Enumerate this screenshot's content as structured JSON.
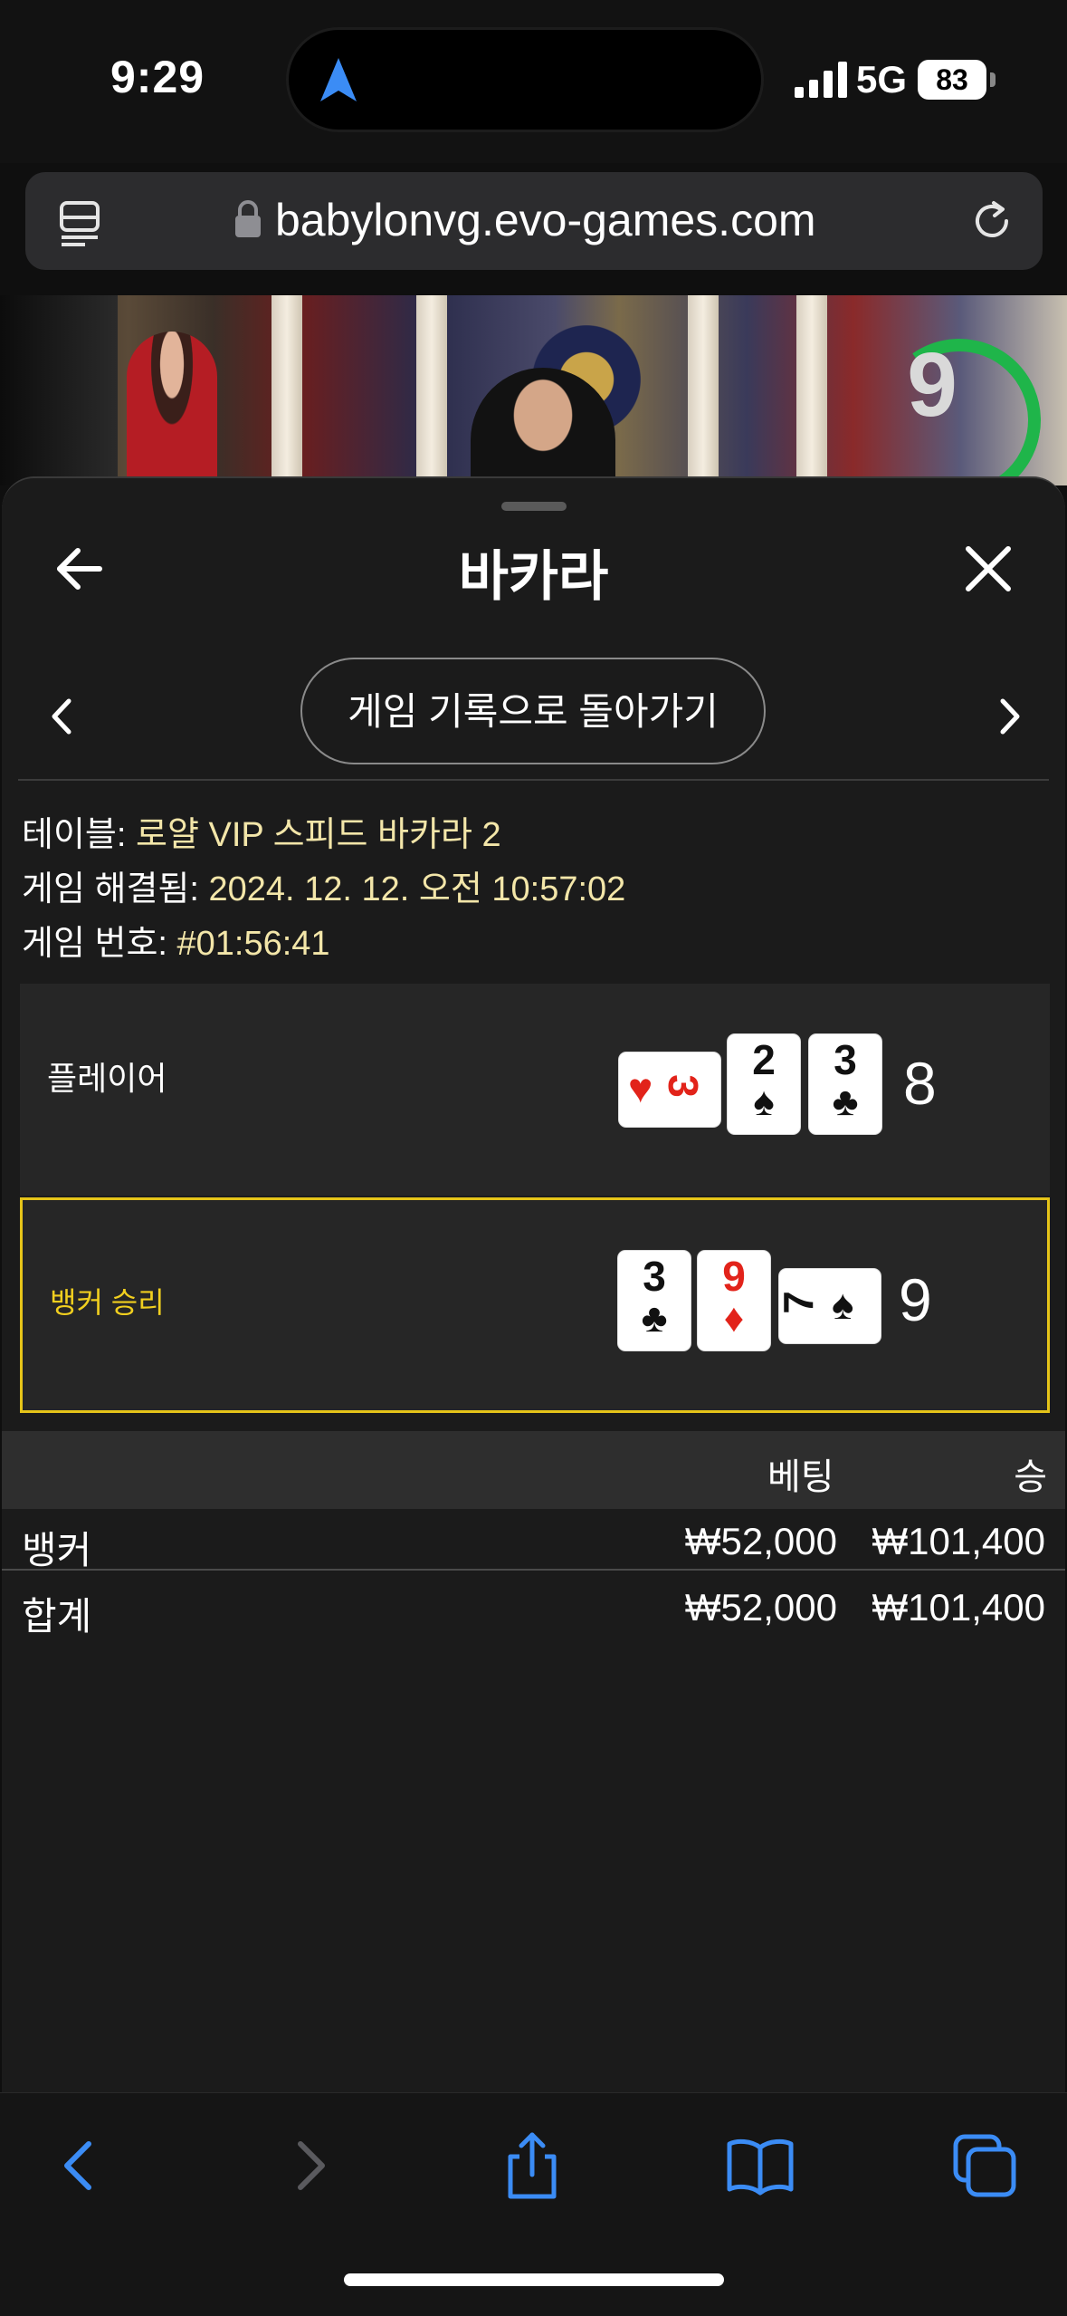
{
  "status_bar": {
    "time": "9:29",
    "network": "5G",
    "battery": "83"
  },
  "browser": {
    "url": "babylonvg.evo-games.com"
  },
  "video": {
    "timer": "9"
  },
  "sheet": {
    "title": "바카라",
    "return_button": "게임 기록으로 돌아가기",
    "info": {
      "table_label": "테이블: ",
      "table_value": "로얄 VIP 스피드 바카라 2",
      "resolved_label": "게임 해결됨: ",
      "resolved_value": "2024. 12. 12. 오전 10:57:02",
      "number_label": "게임 번호: ",
      "number_value": "#01:56:41"
    },
    "player": {
      "label": "플레이어",
      "cards": [
        {
          "rank": "3",
          "suit": "♥",
          "color": "red",
          "orientation": "sideways"
        },
        {
          "rank": "2",
          "suit": "♠",
          "color": "black",
          "orientation": "upright"
        },
        {
          "rank": "3",
          "suit": "♣",
          "color": "black",
          "orientation": "upright"
        }
      ],
      "total": "8"
    },
    "banker": {
      "label": "뱅커 승리",
      "cards": [
        {
          "rank": "3",
          "suit": "♣",
          "color": "black",
          "orientation": "upright"
        },
        {
          "rank": "9",
          "suit": "♦",
          "color": "red",
          "orientation": "upright"
        },
        {
          "rank": "7",
          "suit": "♠",
          "color": "black",
          "orientation": "sideways"
        }
      ],
      "total": "9",
      "highlight_color": "#e5c419"
    },
    "bets": {
      "header_bet": "베팅",
      "header_win": "승",
      "rows": [
        {
          "name": "뱅커",
          "bet": "₩52,000",
          "win": "₩101,400"
        },
        {
          "name": "합계",
          "bet": "₩52,000",
          "win": "₩101,400"
        }
      ]
    }
  },
  "toolbar": {
    "items": [
      "back-icon",
      "forward-icon",
      "share-icon",
      "bookmarks-icon",
      "tabs-icon"
    ],
    "accent": "#3b8cf5"
  }
}
